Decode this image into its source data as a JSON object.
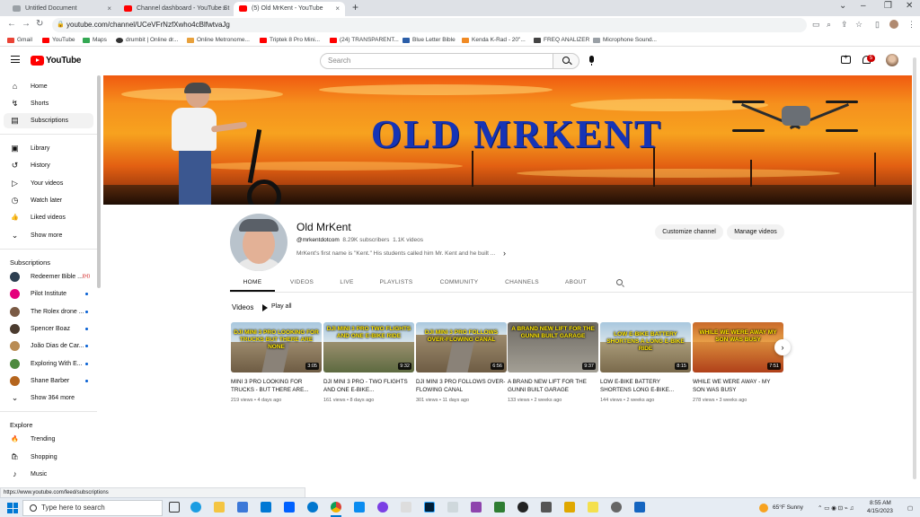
{
  "browser": {
    "tabs": [
      {
        "title": "Untitled Document",
        "color": "#9aa0a6"
      },
      {
        "title": "Channel dashboard - YouTube St",
        "color": "#ff0000"
      },
      {
        "title": "(5) Old MrKent - YouTube",
        "color": "#ff0000"
      }
    ],
    "url": "youtube.com/channel/UCeVFrNzfXwho4cBlfwtvaJg",
    "bookmarks": [
      {
        "label": "Gmail",
        "color": "#ea4335"
      },
      {
        "label": "YouTube",
        "color": "#ff0000"
      },
      {
        "label": "Maps",
        "color": "#34a853"
      },
      {
        "label": "drumbit | Online dr...",
        "color": "#333333"
      },
      {
        "label": "Online Metronome...",
        "color": "#e8a13c"
      },
      {
        "label": "Triptek 8 Pro Mini...",
        "color": "#ff0000"
      },
      {
        "label": "(24) TRANSPARENT...",
        "color": "#ff0000"
      },
      {
        "label": "Blue Letter Bible",
        "color": "#2b5ea8"
      },
      {
        "label": "Kenda K-Rad - 20\"...",
        "color": "#f08a24"
      },
      {
        "label": "FREQ ANALIZER",
        "color": "#444444"
      },
      {
        "label": "Microphone Sound...",
        "color": "#9aa0a6"
      }
    ],
    "status_url": "https://www.youtube.com/feed/subscriptions"
  },
  "header": {
    "logo_text": "YouTube",
    "search_placeholder": "Search",
    "notification_count": "5"
  },
  "sidebar": {
    "main_items": [
      {
        "label": "Home",
        "icon": "home-icon",
        "glyph": "⌂"
      },
      {
        "label": "Shorts",
        "icon": "shorts-icon",
        "glyph": "↯"
      },
      {
        "label": "Subscriptions",
        "icon": "subscriptions-icon",
        "glyph": "▤"
      }
    ],
    "you_items": [
      {
        "label": "Library",
        "icon": "library-icon",
        "glyph": "▣"
      },
      {
        "label": "History",
        "icon": "history-icon",
        "glyph": "↺"
      },
      {
        "label": "Your videos",
        "icon": "your-videos-icon",
        "glyph": "▷"
      },
      {
        "label": "Watch later",
        "icon": "clock-icon",
        "glyph": "◷"
      },
      {
        "label": "Liked videos",
        "icon": "thumbs-up-icon",
        "glyph": "👍"
      },
      {
        "label": "Show more",
        "icon": "chevron-down-icon",
        "glyph": "⌄"
      }
    ],
    "subscriptions_heading": "Subscriptions",
    "subscriptions": [
      {
        "label": "Redeemer Bible ...",
        "color": "#2c3e50",
        "live": "((•))"
      },
      {
        "label": "Pilot Institute",
        "color": "#e4007c",
        "dot": true
      },
      {
        "label": "The Rolex drone ...",
        "color": "#7a5a44",
        "dot": true
      },
      {
        "label": "Spencer Boaz",
        "color": "#4b3b2f",
        "dot": true
      },
      {
        "label": "João Dias de Car...",
        "color": "#b98c54",
        "dot": true
      },
      {
        "label": "Exploring With E...",
        "color": "#4d8a3e",
        "dot": true
      },
      {
        "label": "Shane Barber",
        "color": "#b5651d",
        "dot": true
      },
      {
        "label": "Show 364 more",
        "glyph": "⌄"
      }
    ],
    "explore_heading": "Explore",
    "explore_items": [
      {
        "label": "Trending",
        "icon": "trending-icon",
        "glyph": "🔥"
      },
      {
        "label": "Shopping",
        "icon": "shopping-bag-icon",
        "glyph": "🛍"
      },
      {
        "label": "Music",
        "icon": "music-note-icon",
        "glyph": "♪"
      }
    ]
  },
  "banner": {
    "title": "OLD MRKENT"
  },
  "channel": {
    "name": "Old MrKent",
    "handle": "@mrkentdotcom",
    "subscribers": "8.29K subscribers",
    "videos_count": "1.1K videos",
    "description": "MrKent's first name is \"Kent.\" His students called him Mr. Kent and he built ...",
    "customize_label": "Customize channel",
    "manage_label": "Manage videos",
    "tabs": [
      "HOME",
      "VIDEOS",
      "LIVE",
      "PLAYLISTS",
      "COMMUNITY",
      "CHANNELS",
      "ABOUT"
    ]
  },
  "videos_section": {
    "title": "Videos",
    "play_all": "Play all",
    "videos": [
      {
        "caption": "DJI MINI 3 PRO LOOKING FOR TRUCKS BUT THERE ARE NONE",
        "duration": "3:05",
        "title": "MINI 3 PRO LOOKING FOR TRUCKS - BUT THERE ARE...",
        "views": "219 views",
        "age": "4 days ago",
        "theme": "road"
      },
      {
        "caption": "DJI MINI 3 PRO TWO FLIGHTS AND ONE E-BIKE RIDE",
        "duration": "9:32",
        "title": "DJI MINI 3 PRO - TWO FLIGHTS AND ONE E-BIKE...",
        "views": "161 views",
        "age": "8 days ago",
        "theme": "field"
      },
      {
        "caption": "DJI MINI 3 PRO FOLLOWS OVER-FLOWING CANAL",
        "duration": "6:56",
        "title": "DJI MINI 3 PRO FOLLOWS OVER-FLOWING CANAL",
        "views": "301 views",
        "age": "11 days ago",
        "theme": "road"
      },
      {
        "caption": "A BRAND NEW LIFT FOR THE GUNNI BUILT GARAGE",
        "duration": "9:37",
        "title": "A BRAND NEW LIFT FOR THE GUNNI BUILT GARAGE",
        "views": "133 views",
        "age": "2 weeks ago",
        "theme": "garage"
      },
      {
        "caption": "LOW E-BIKE BATTERY SHORTENS A LONG E-BIKE RIDE",
        "duration": "8:15",
        "title": "LOW E-BIKE BATTERY SHORTENS LONG E-BIKE...",
        "views": "144 views",
        "age": "2 weeks ago",
        "theme": "field"
      },
      {
        "caption": "WHILE WE WERE AWAY MY SON WAS BUSY",
        "duration": "7:51",
        "title": "WHILE WE WERE AWAY - MY SON WAS BUSY",
        "views": "278 views",
        "age": "3 weeks ago",
        "theme": "sunset"
      }
    ]
  },
  "taskbar": {
    "search_placeholder": "Type here to search",
    "weather": "65°F  Sunny",
    "time": "8:55 AM",
    "date": "4/15/2023",
    "apps": [
      {
        "icon": "task-view-icon",
        "color": "#333333"
      },
      {
        "icon": "edge-icon",
        "color": "#1b9de2"
      },
      {
        "icon": "explorer-icon",
        "color": "#f4c542"
      },
      {
        "icon": "store-icon",
        "color": "#3c78d8"
      },
      {
        "icon": "mail-icon",
        "color": "#0078d4"
      },
      {
        "icon": "dropbox-icon",
        "color": "#0061ff"
      },
      {
        "icon": "dell-icon",
        "color": "#0076ce"
      },
      {
        "icon": "chrome-icon",
        "color": "#db4437"
      },
      {
        "icon": "app-icon",
        "color": "#0a8cf0"
      },
      {
        "icon": "headphones-icon",
        "color": "#7b3fe4"
      },
      {
        "icon": "document-icon",
        "color": "#dddddd"
      },
      {
        "icon": "photoshop-icon",
        "color": "#31a8ff"
      },
      {
        "icon": "notepad-icon",
        "color": "#cfd8dc"
      },
      {
        "icon": "winrar-icon",
        "color": "#8e44ad"
      },
      {
        "icon": "media-icon",
        "color": "#2e7d32"
      },
      {
        "icon": "alien-icon",
        "color": "#222222"
      },
      {
        "icon": "calculator-icon",
        "color": "#555555"
      },
      {
        "icon": "folder-icon",
        "color": "#e0a800"
      },
      {
        "icon": "sticky-icon",
        "color": "#f4e04d"
      },
      {
        "icon": "settings-icon",
        "color": "#666666"
      },
      {
        "icon": "display-icon",
        "color": "#1565c0"
      }
    ]
  }
}
